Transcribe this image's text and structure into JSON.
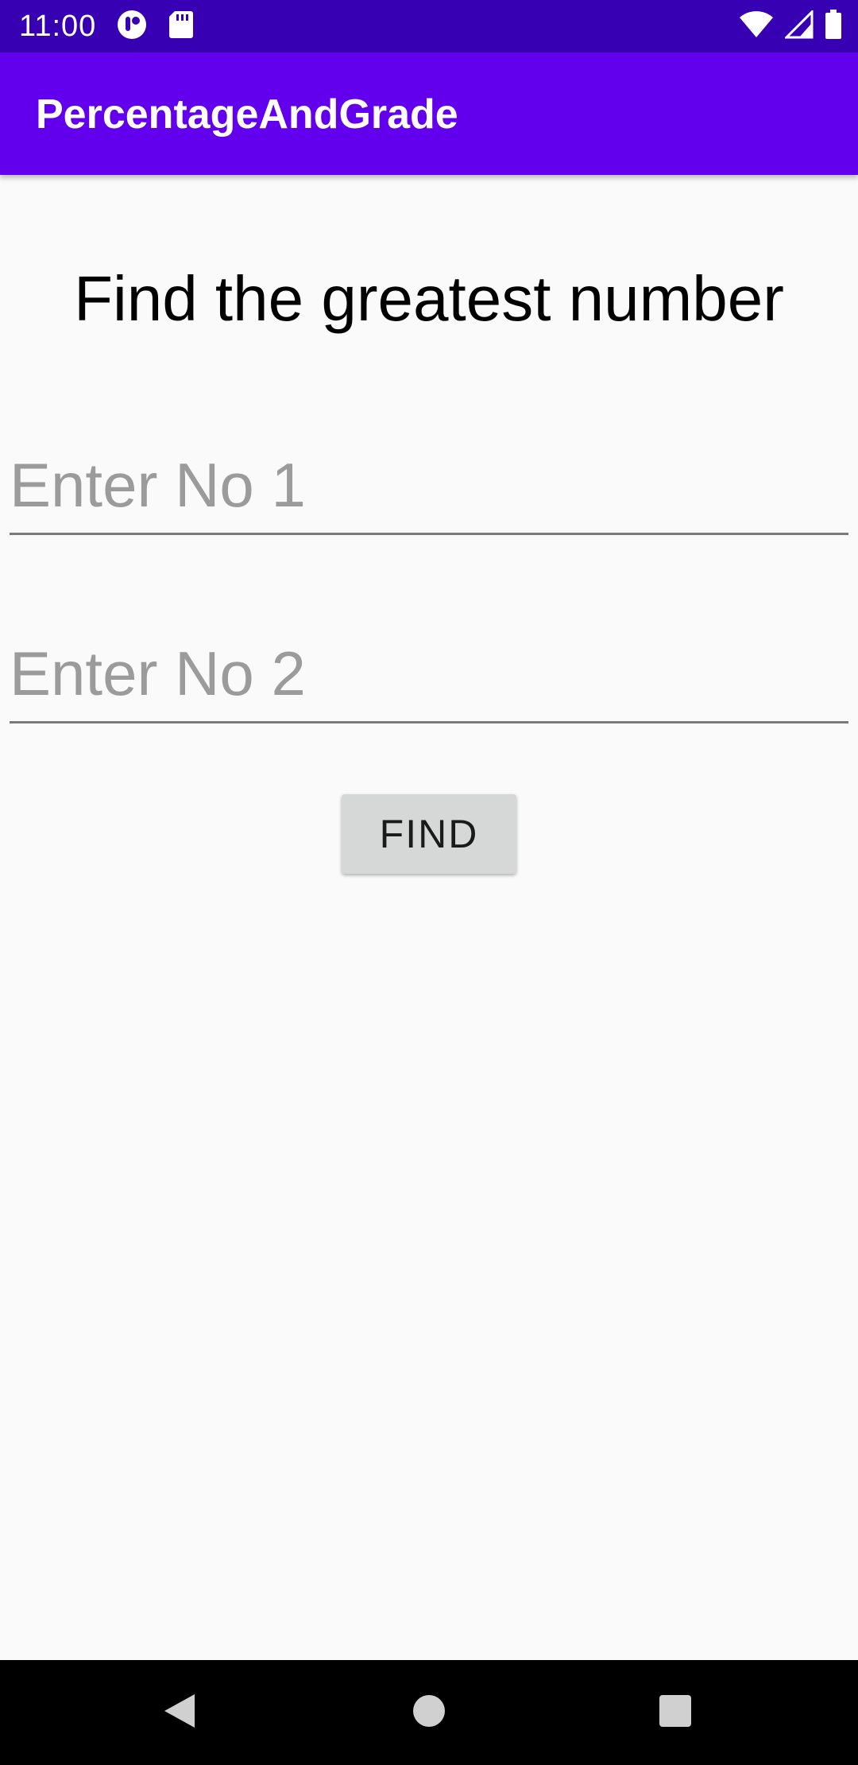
{
  "status_bar": {
    "time": "11:00",
    "background_color": "#3700b3",
    "left_icons": [
      "app-notification-icon",
      "sd-card-icon"
    ],
    "right_icons": [
      "wifi-icon",
      "cell-signal-icon",
      "battery-icon"
    ]
  },
  "app_bar": {
    "title": "PercentageAndGrade",
    "background_color": "#6200ee"
  },
  "main": {
    "heading": "Find the greatest number",
    "input_1": {
      "value": "",
      "placeholder": "Enter No 1"
    },
    "input_2": {
      "value": "",
      "placeholder": "Enter No 2"
    },
    "find_button_label": "FIND"
  },
  "nav_bar": {
    "items": [
      "back-icon",
      "home-icon",
      "recents-icon"
    ]
  }
}
